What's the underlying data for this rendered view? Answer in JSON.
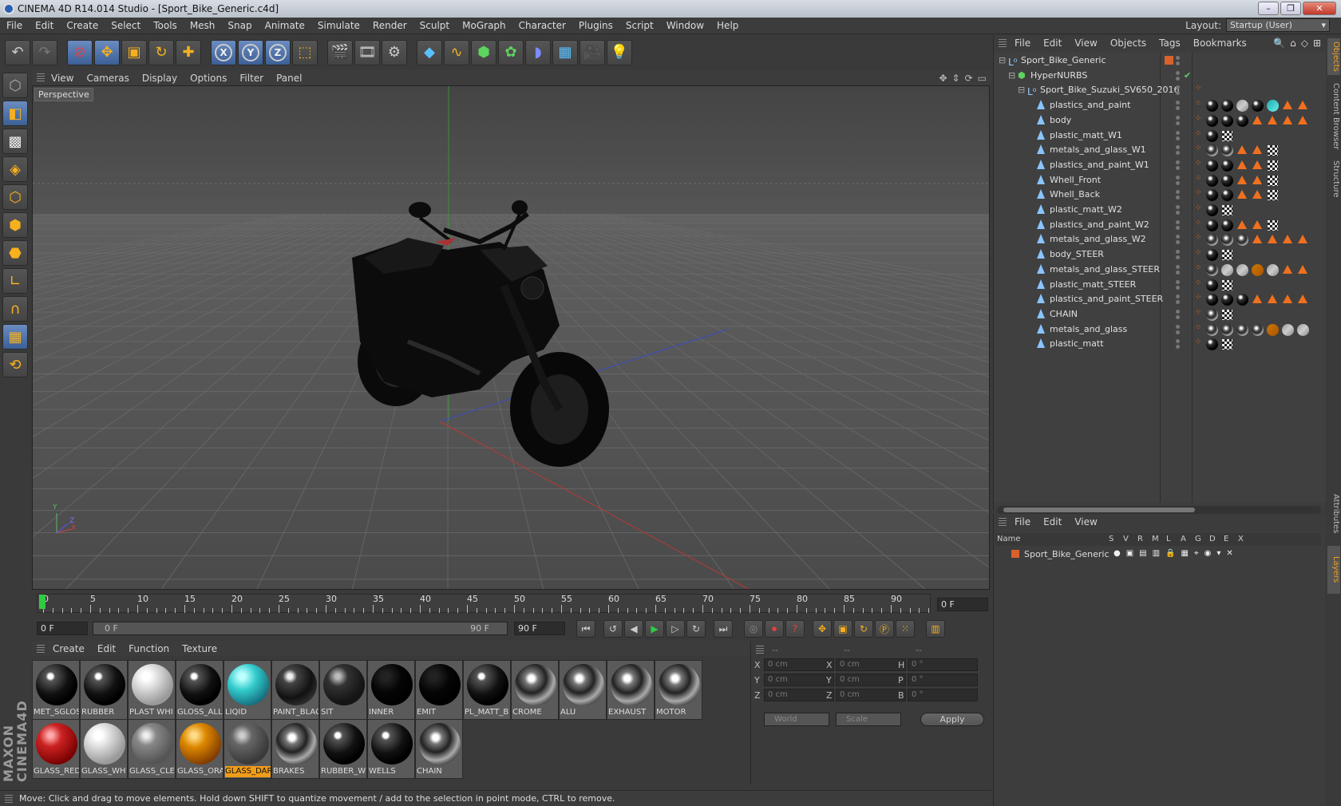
{
  "window": {
    "title": "CINEMA 4D R14.014 Studio - [Sport_Bike_Generic.c4d]"
  },
  "menubar": [
    "File",
    "Edit",
    "Create",
    "Select",
    "Tools",
    "Mesh",
    "Snap",
    "Animate",
    "Simulate",
    "Render",
    "Sculpt",
    "MoGraph",
    "Character",
    "Plugins",
    "Script",
    "Window",
    "Help"
  ],
  "layout": {
    "label": "Layout:",
    "value": "Startup (User)"
  },
  "viewport": {
    "menu": [
      "View",
      "Cameras",
      "Display",
      "Options",
      "Filter",
      "Panel"
    ],
    "label": "Perspective",
    "axis_x": "X",
    "axis_y": "Y",
    "axis_z": "Z"
  },
  "timeline": {
    "ticks": [
      "0",
      "5",
      "10",
      "15",
      "20",
      "25",
      "30",
      "35",
      "40",
      "45",
      "50",
      "55",
      "60",
      "65",
      "70",
      "75",
      "80",
      "85",
      "90"
    ],
    "current": "0 F",
    "start": "0 F",
    "range_start": "0 F",
    "range_end": "90 F",
    "end": "90 F"
  },
  "materials": {
    "menu": [
      "Create",
      "Edit",
      "Function",
      "Texture"
    ],
    "items": [
      {
        "label": "MET_SGLOS",
        "style": "black"
      },
      {
        "label": "RUBBER",
        "style": "black"
      },
      {
        "label": "PLAST WHI",
        "style": "white"
      },
      {
        "label": "GLOSS_ALL",
        "style": "black"
      },
      {
        "label": "LIQID",
        "style": "cyan"
      },
      {
        "label": "PAINT_BLAC",
        "style": "blackchrome"
      },
      {
        "label": "SIT",
        "style": "darkgrey"
      },
      {
        "label": "INNER",
        "style": "pureblack"
      },
      {
        "label": "EMIT",
        "style": "pureblack"
      },
      {
        "label": "PL_MATT_B",
        "style": "black"
      },
      {
        "label": "CROME",
        "style": "chrome"
      },
      {
        "label": "ALU",
        "style": "chrome"
      },
      {
        "label": "EXHAUST",
        "style": "chrome"
      },
      {
        "label": "MOTOR",
        "style": "chrome"
      },
      {
        "label": "GLASS_RED",
        "style": "red"
      },
      {
        "label": "GLASS_WH",
        "style": "white"
      },
      {
        "label": "GLASS_CLE",
        "style": "clear"
      },
      {
        "label": "GLASS_ORA",
        "style": "orange"
      },
      {
        "label": "GLASS_DAR",
        "style": "dark",
        "selected": true
      },
      {
        "label": "BRAKES",
        "style": "chrome"
      },
      {
        "label": "RUBBER_W",
        "style": "black"
      },
      {
        "label": "WELLS",
        "style": "black"
      },
      {
        "label": "CHAIN",
        "style": "chrome"
      }
    ]
  },
  "coords": {
    "headers": [
      "--",
      "--",
      "--"
    ],
    "rows": [
      {
        "a": "X",
        "av": "0 cm",
        "b": "X",
        "bv": "0 cm",
        "c": "H",
        "cv": "0 °"
      },
      {
        "a": "Y",
        "av": "0 cm",
        "b": "Y",
        "bv": "0 cm",
        "c": "P",
        "cv": "0 °"
      },
      {
        "a": "Z",
        "av": "0 cm",
        "b": "Z",
        "bv": "0 cm",
        "c": "B",
        "cv": "0 °"
      }
    ],
    "space": "World",
    "mode": "Scale",
    "apply": "Apply"
  },
  "status": "Move: Click and drag to move elements. Hold down SHIFT to quantize movement / add to the selection in point mode, CTRL to remove.",
  "objects": {
    "menu": [
      "File",
      "Edit",
      "View",
      "Objects",
      "Tags",
      "Bookmarks"
    ],
    "rows": [
      {
        "name": "Sport_Bike_Generic",
        "level": 0,
        "tags": []
      },
      {
        "name": "HyperNURBS",
        "level": 1,
        "tags": []
      },
      {
        "name": "Sport_Bike_Suzuki_SV650_2016",
        "level": 2,
        "tags": []
      },
      {
        "name": "plastics_and_paint",
        "level": 3,
        "tags": [
          "b",
          "b",
          "g",
          "b",
          "c",
          "t",
          "t"
        ]
      },
      {
        "name": "body",
        "level": 3,
        "tags": [
          "b",
          "b",
          "b",
          "t",
          "t",
          "t",
          "t"
        ]
      },
      {
        "name": "plastic_matt_W1",
        "level": 3,
        "tags": [
          "b",
          "k"
        ]
      },
      {
        "name": "metals_and_glass_W1",
        "level": 3,
        "tags": [
          "m",
          "m",
          "t",
          "t",
          "k"
        ]
      },
      {
        "name": "plastics_and_paint_W1",
        "level": 3,
        "tags": [
          "b",
          "b",
          "t",
          "t",
          "k"
        ]
      },
      {
        "name": "Whell_Front",
        "level": 3,
        "tags": [
          "b",
          "b",
          "t",
          "t",
          "k"
        ]
      },
      {
        "name": "Whell_Back",
        "level": 3,
        "tags": [
          "b",
          "b",
          "t",
          "t",
          "k"
        ]
      },
      {
        "name": "plastic_matt_W2",
        "level": 3,
        "tags": [
          "b",
          "k"
        ]
      },
      {
        "name": "plastics_and_paint_W2",
        "level": 3,
        "tags": [
          "b",
          "b",
          "t",
          "t",
          "k"
        ]
      },
      {
        "name": "metals_and_glass_W2",
        "level": 3,
        "tags": [
          "m",
          "m",
          "m",
          "t",
          "t",
          "t",
          "t"
        ]
      },
      {
        "name": "body_STEER",
        "level": 3,
        "tags": [
          "b",
          "k"
        ]
      },
      {
        "name": "metals_and_glass_STEER",
        "level": 3,
        "tags": [
          "m",
          "g",
          "g",
          "o",
          "g",
          "t",
          "t"
        ]
      },
      {
        "name": "plastic_matt_STEER",
        "level": 3,
        "tags": [
          "b",
          "k"
        ]
      },
      {
        "name": "plastics_and_paint_STEER",
        "level": 3,
        "tags": [
          "b",
          "b",
          "b",
          "t",
          "t",
          "t",
          "t"
        ]
      },
      {
        "name": "CHAIN",
        "level": 3,
        "tags": [
          "m",
          "k"
        ]
      },
      {
        "name": "metals_and_glass",
        "level": 3,
        "tags": [
          "m",
          "m",
          "m",
          "m",
          "o",
          "g",
          "g"
        ]
      },
      {
        "name": "plastic_matt",
        "level": 3,
        "tags": [
          "b",
          "k"
        ]
      }
    ]
  },
  "attributes": {
    "menu": [
      "File",
      "Edit",
      "View"
    ],
    "columns": [
      "Name",
      "S",
      "V",
      "R",
      "M",
      "L",
      "A",
      "G",
      "D",
      "E",
      "X"
    ],
    "row": "Sport_Bike_Generic"
  },
  "sidetabs": [
    "Objects",
    "Content Browser",
    "Structure",
    "Attributes",
    "Layers"
  ],
  "colors": {
    "accent": "#f09d18",
    "selection": "#3c5f96",
    "bg": "#3a3a3a"
  }
}
